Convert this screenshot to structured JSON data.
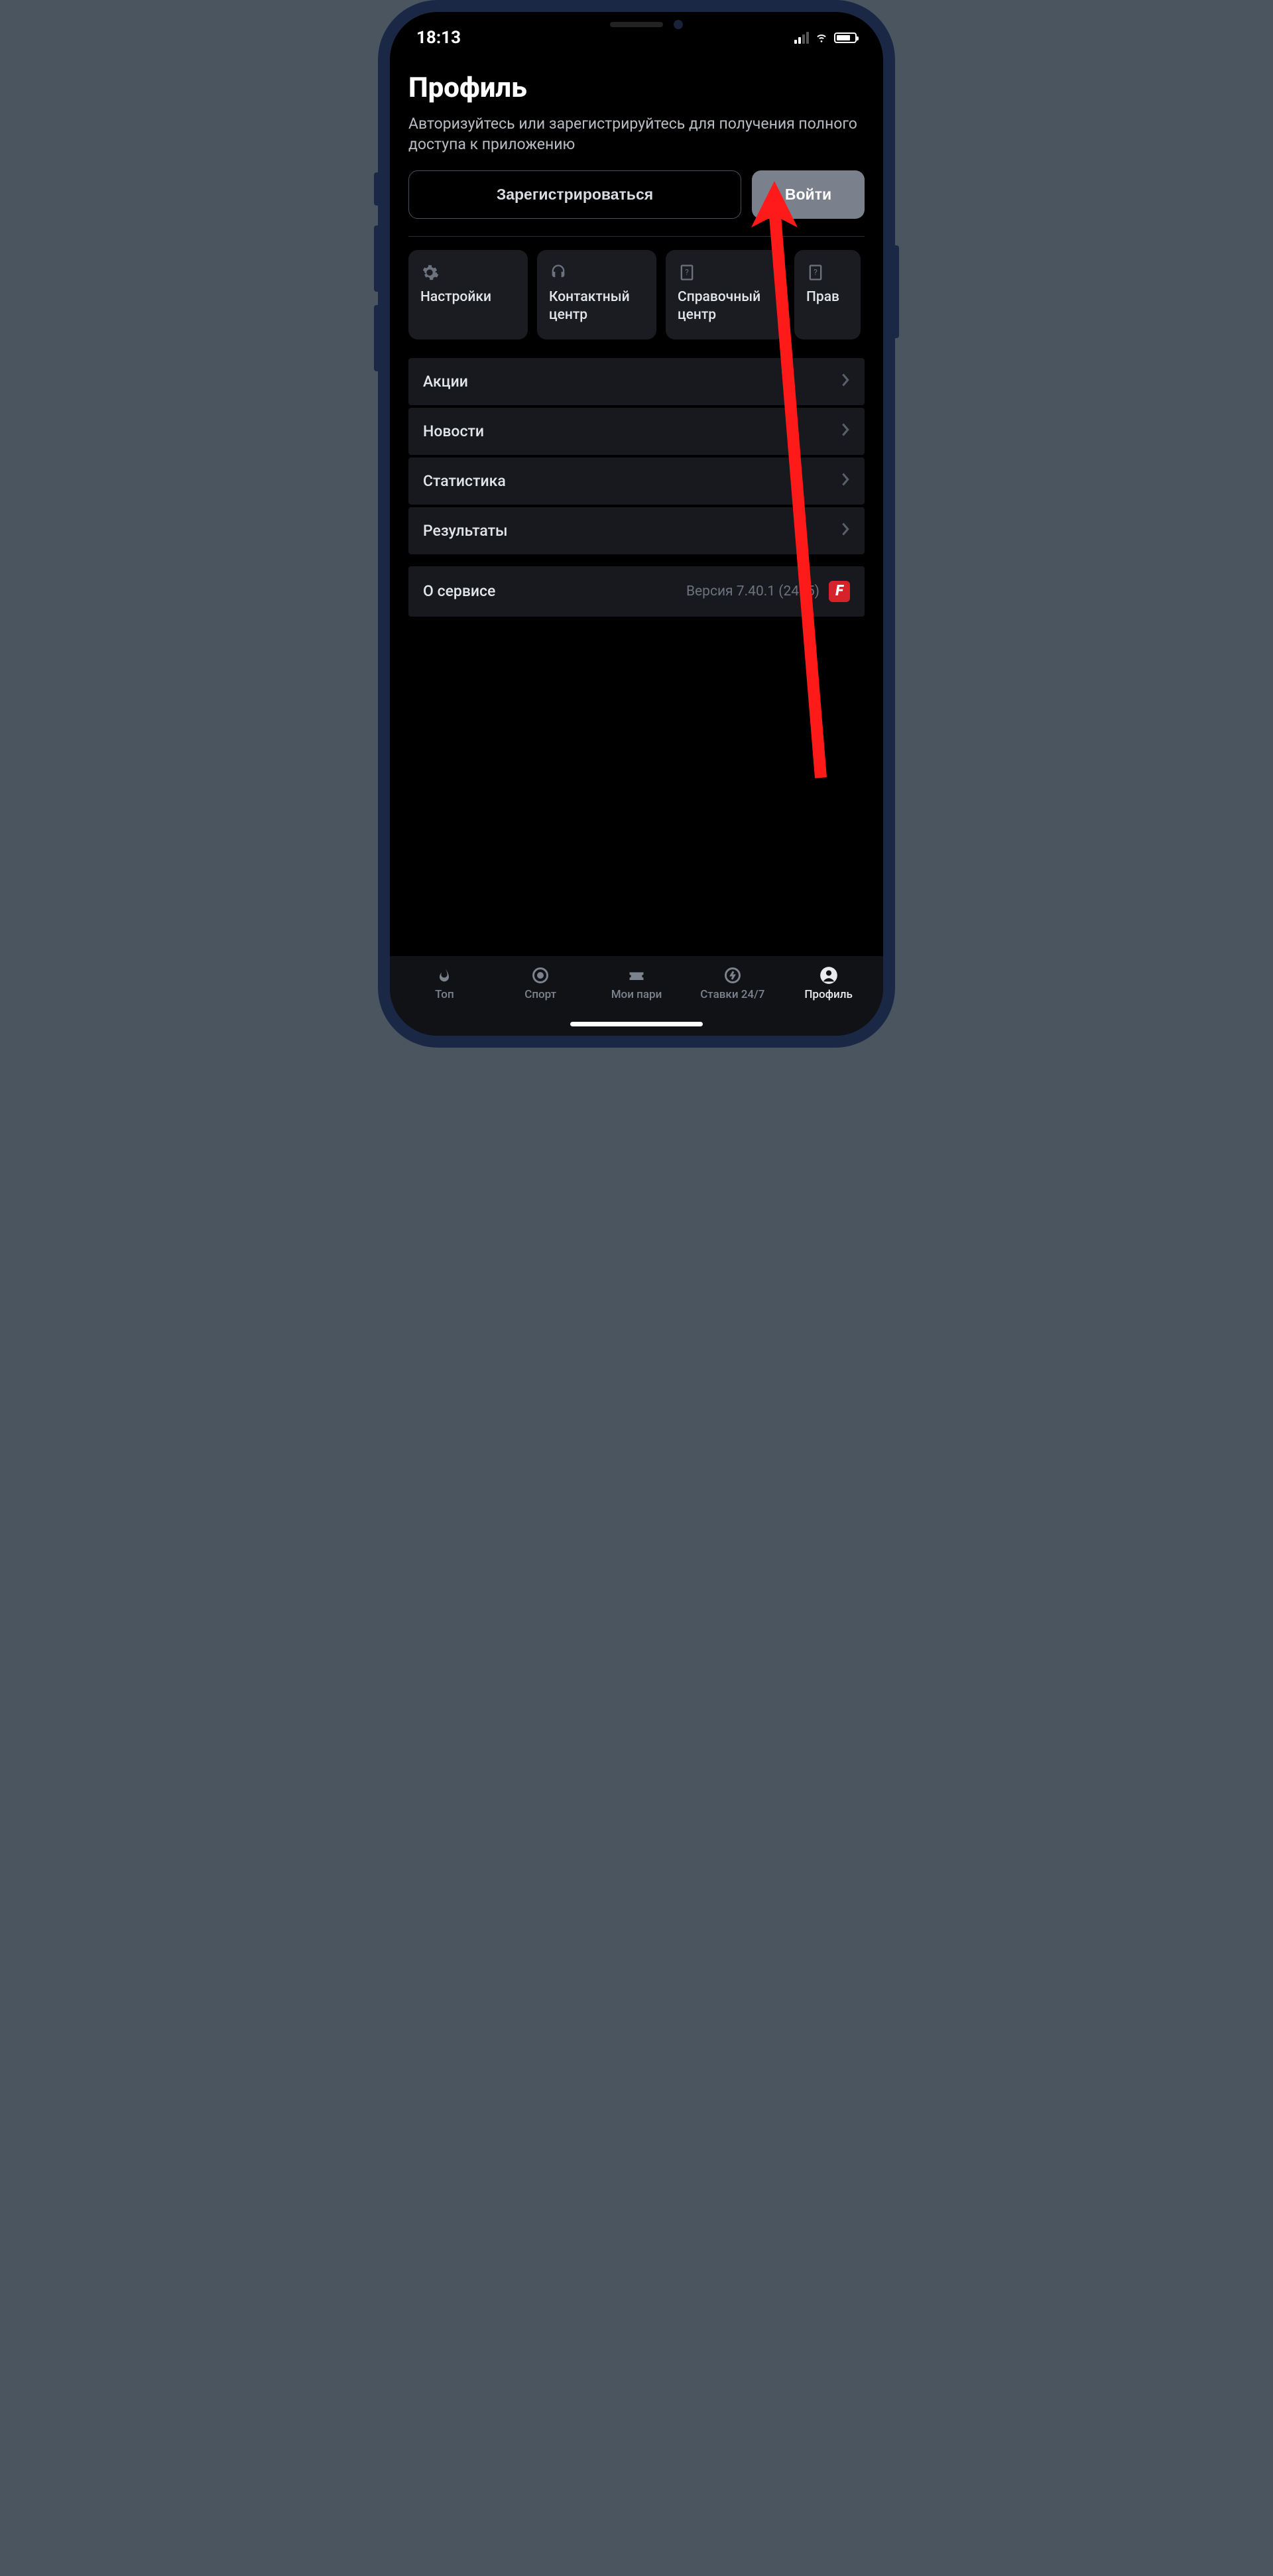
{
  "status": {
    "time": "18:13"
  },
  "profile": {
    "title": "Профиль",
    "subtitle": "Авторизуйтесь или зарегистрируйтесь для получения полного доступа к приложению",
    "register_label": "Зарегистрироваться",
    "login_label": "Войти"
  },
  "tiles": [
    {
      "label": "Настройки"
    },
    {
      "label": "Контактный\nцентр"
    },
    {
      "label": "Справочный\nцентр"
    },
    {
      "label": "Прав"
    }
  ],
  "list": [
    {
      "label": "Акции"
    },
    {
      "label": "Новости"
    },
    {
      "label": "Статистика"
    },
    {
      "label": "Результаты"
    }
  ],
  "about": {
    "label": "О сервисе",
    "version": "Версия 7.40.1 (2425)",
    "badge": "F"
  },
  "tabs": [
    {
      "label": "Топ"
    },
    {
      "label": "Спорт"
    },
    {
      "label": "Мои пари"
    },
    {
      "label": "Ставки 24/7"
    },
    {
      "label": "Профиль"
    }
  ]
}
